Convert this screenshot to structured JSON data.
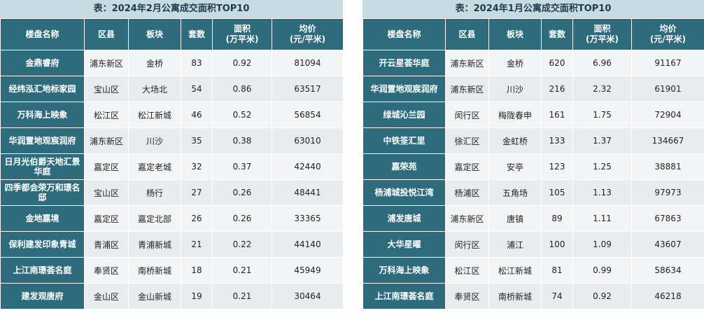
{
  "left": {
    "title": "表：2024年2月公寓成交面积TOP10",
    "headers": {
      "name": "楼盘名称",
      "district": "区县",
      "block": "板块",
      "units": "套数",
      "area_line1": "面积",
      "area_line2": "(万平米)",
      "price_line1": "均价",
      "price_line2": "(元/平米)"
    },
    "rows": [
      {
        "name": "金鼎睿府",
        "district": "浦东新区",
        "block": "金桥",
        "units": "83",
        "area": "0.92",
        "price": "81094"
      },
      {
        "name": "经纬泓汇地标家园",
        "district": "宝山区",
        "block": "大场北",
        "units": "54",
        "area": "0.86",
        "price": "63517"
      },
      {
        "name": "万科海上映象",
        "district": "松江区",
        "block": "松江新城",
        "units": "46",
        "area": "0.52",
        "price": "56854"
      },
      {
        "name": "华润置地观宸润府",
        "district": "浦东新区",
        "block": "川沙",
        "units": "35",
        "area": "0.38",
        "price": "63010"
      },
      {
        "name": "日月光伯爵天地汇景华庭",
        "district": "嘉定区",
        "block": "嘉定老城",
        "units": "32",
        "area": "0.37",
        "price": "42440"
      },
      {
        "name": "四季都会荣万和璟名邸",
        "district": "宝山区",
        "block": "杨行",
        "units": "27",
        "area": "0.26",
        "price": "48441"
      },
      {
        "name": "金地嘉境",
        "district": "嘉定区",
        "block": "嘉定北部",
        "units": "26",
        "area": "0.26",
        "price": "33365"
      },
      {
        "name": "保利建发印象青城",
        "district": "青浦区",
        "block": "青浦新城",
        "units": "21",
        "area": "0.22",
        "price": "44140"
      },
      {
        "name": "上江南璟荟名庭",
        "district": "奉贤区",
        "block": "南桥新城",
        "units": "18",
        "area": "0.21",
        "price": "45949"
      },
      {
        "name": "建发观唐府",
        "district": "金山区",
        "block": "金山新城",
        "units": "19",
        "area": "0.21",
        "price": "30464"
      }
    ]
  },
  "right": {
    "title": "表：2024年1月公寓成交面积TOP10",
    "headers": {
      "name": "楼盘名称",
      "district": "区县",
      "block": "板块",
      "units": "套数",
      "area_line1": "面积",
      "area_line2": "(万平米)",
      "price_line1": "均价",
      "price_line2": "(元/平米)"
    },
    "rows": [
      {
        "name": "开云星荟华庭",
        "district": "浦东新区",
        "block": "金桥",
        "units": "620",
        "area": "6.96",
        "price": "91167"
      },
      {
        "name": "华润置地观宸润府",
        "district": "浦东新区",
        "block": "川沙",
        "units": "216",
        "area": "2.32",
        "price": "61901"
      },
      {
        "name": "绿城沁兰园",
        "district": "闵行区",
        "block": "梅陇春申",
        "units": "161",
        "area": "1.75",
        "price": "72904"
      },
      {
        "name": "中铁筌汇里",
        "district": "徐汇区",
        "block": "金虹桥",
        "units": "133",
        "area": "1.37",
        "price": "134667"
      },
      {
        "name": "嘉荣苑",
        "district": "嘉定区",
        "block": "安亭",
        "units": "123",
        "area": "1.25",
        "price": "38881"
      },
      {
        "name": "杨浦城投悦江湾",
        "district": "杨浦区",
        "block": "五角场",
        "units": "105",
        "area": "1.13",
        "price": "97973"
      },
      {
        "name": "浦发唐城",
        "district": "浦东新区",
        "block": "唐镇",
        "units": "89",
        "area": "1.11",
        "price": "67863"
      },
      {
        "name": "大华星曜",
        "district": "闵行区",
        "block": "浦江",
        "units": "100",
        "area": "1.09",
        "price": "43607"
      },
      {
        "name": "万科海上映象",
        "district": "松江区",
        "block": "松江新城",
        "units": "81",
        "area": "0.99",
        "price": "58634"
      },
      {
        "name": "上江南璟荟名庭",
        "district": "奉贤区",
        "block": "南桥新城",
        "units": "74",
        "area": "0.92",
        "price": "46218"
      }
    ]
  }
}
